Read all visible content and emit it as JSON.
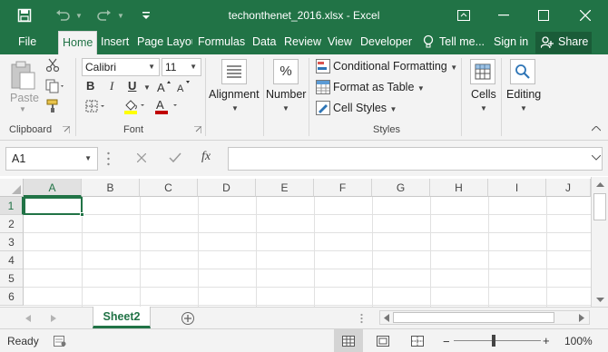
{
  "window": {
    "title": "techonthenet_2016.xlsx - Excel"
  },
  "tabs": [
    {
      "label": "File"
    },
    {
      "label": "Home"
    },
    {
      "label": "Insert"
    },
    {
      "label": "Page Layout"
    },
    {
      "label": "Formulas"
    },
    {
      "label": "Data"
    },
    {
      "label": "Review"
    },
    {
      "label": "View"
    },
    {
      "label": "Developer"
    }
  ],
  "tell_me": "Tell me...",
  "sign_in": "Sign in",
  "share": "Share",
  "ribbon": {
    "clipboard": {
      "paste": "Paste",
      "group": "Clipboard"
    },
    "font": {
      "name": "Calibri",
      "size": "11",
      "group": "Font",
      "bold": "B",
      "italic": "I",
      "underline": "U"
    },
    "alignment": {
      "label": "Alignment"
    },
    "number": {
      "label": "Number",
      "icon_text": "%"
    },
    "styles": {
      "conditional": "Conditional Formatting",
      "table": "Format as Table",
      "cell_styles": "Cell Styles",
      "group": "Styles"
    },
    "cells": {
      "label": "Cells"
    },
    "editing": {
      "label": "Editing"
    }
  },
  "formula_bar": {
    "name_box": "A1",
    "fx": "fx",
    "value": ""
  },
  "grid": {
    "columns": [
      "A",
      "B",
      "C",
      "D",
      "E",
      "F",
      "G",
      "H",
      "I",
      "J"
    ],
    "rows": [
      "1",
      "2",
      "3",
      "4",
      "5",
      "6"
    ],
    "selected_cell": "A1"
  },
  "sheets": [
    {
      "name": "Sheet2"
    }
  ],
  "status": {
    "text": "Ready",
    "zoom": "100%"
  },
  "colors": {
    "accent": "#217346",
    "ribbon_bg": "#f3f3f3",
    "font_color_swatch": "#c00000",
    "highlight_swatch": "#ffff00"
  }
}
